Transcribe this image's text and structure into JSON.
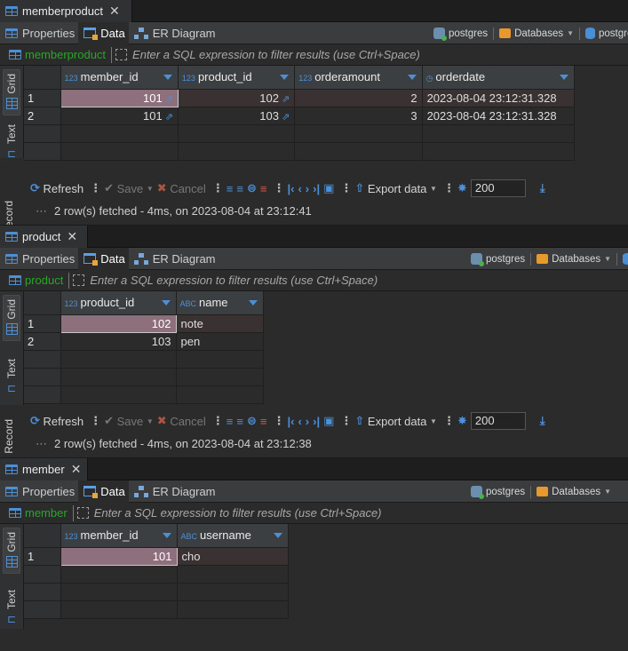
{
  "subtabs": {
    "properties": "Properties",
    "data": "Data",
    "er": "ER Diagram"
  },
  "connection": {
    "postgres": "postgres",
    "databases": "Databases",
    "db": "postgres"
  },
  "filter_placeholder": "Enter a SQL expression to filter results (use Ctrl+Space)",
  "vtabs": {
    "grid": "Grid",
    "text": "Text",
    "record": "Record"
  },
  "toolbar": {
    "refresh": "Refresh",
    "save": "Save",
    "cancel": "Cancel",
    "export": "Export data",
    "limit": "200"
  },
  "type_badges": {
    "num": "123",
    "abc": "ABC"
  },
  "editors": [
    {
      "tab": "memberproduct",
      "filter_name": "memberproduct",
      "columns": [
        "member_id",
        "product_id",
        "orderamount",
        "orderdate"
      ],
      "rows": [
        {
          "n": "1",
          "c": [
            "101",
            "102",
            "2",
            "2023-08-04 23:12:31.328"
          ]
        },
        {
          "n": "2",
          "c": [
            "101",
            "103",
            "3",
            "2023-08-04 23:12:31.328"
          ]
        }
      ],
      "status": "2 row(s) fetched - 4ms, on 2023-08-04 at 23:12:41"
    },
    {
      "tab": "product",
      "filter_name": "product",
      "columns": [
        "product_id",
        "name"
      ],
      "rows": [
        {
          "n": "1",
          "c": [
            "102",
            "note"
          ]
        },
        {
          "n": "2",
          "c": [
            "103",
            "pen"
          ]
        }
      ],
      "status": "2 row(s) fetched - 4ms, on 2023-08-04 at 23:12:38"
    },
    {
      "tab": "member",
      "filter_name": "member",
      "columns": [
        "member_id",
        "username"
      ],
      "rows": [
        {
          "n": "1",
          "c": [
            "101",
            "cho"
          ]
        }
      ],
      "status": ""
    }
  ]
}
